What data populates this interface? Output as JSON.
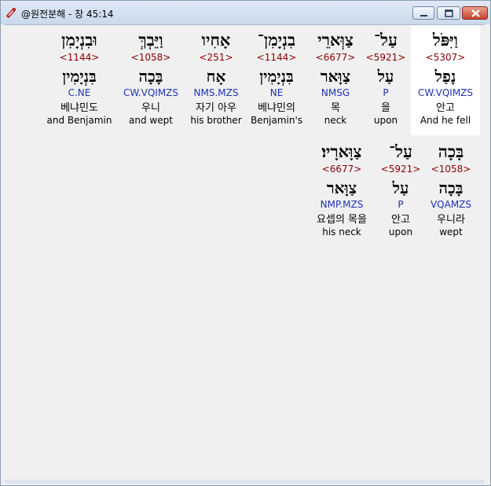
{
  "window": {
    "title": "@원전분해 - 창 45:14",
    "buttons": {
      "minimize": "minimize",
      "maximize": "maximize",
      "close": "close"
    }
  },
  "rows": [
    {
      "words": [
        {
          "hebrew": "וַיִּפֹּל",
          "strong": "<5307>",
          "lemma": "נָפַל",
          "morph": "CW.VQIMZS",
          "korean": "안고",
          "english": "And he fell",
          "highlighted": true
        },
        {
          "hebrew": "עַל־",
          "strong": "<5921>",
          "lemma": "עַל",
          "morph": "P",
          "korean": "을",
          "english": "upon",
          "highlighted": false
        },
        {
          "hebrew": "צַוְּארֵי",
          "strong": "<6677>",
          "lemma": "צַוָּאר",
          "morph": "NMSG",
          "korean": "목",
          "english": "neck",
          "highlighted": false
        },
        {
          "hebrew": "בִנְיָמִן־",
          "strong": "<1144>",
          "lemma": "בִּנְיָמִין",
          "morph": "NE",
          "korean": "베냐민의",
          "english": "Benjamin's",
          "highlighted": false
        },
        {
          "hebrew": "אָחִיו",
          "strong": "<251>",
          "lemma": "אָח",
          "morph": "NMS.MZS",
          "korean": "자기 아우",
          "english": "his brother",
          "highlighted": false
        },
        {
          "hebrew": "וַיֵּבְךְּ",
          "strong": "<1058>",
          "lemma": "בָּכָה",
          "morph": "CW.VQIMZS",
          "korean": "우니",
          "english": "and wept",
          "highlighted": false
        },
        {
          "hebrew": "וּבִנְיָמִן",
          "strong": "<1144>",
          "lemma": "בִּנְיָמִין",
          "morph": "C.NE",
          "korean": "베냐민도",
          "english": "and Benjamin",
          "highlighted": false
        }
      ]
    },
    {
      "words": [
        {
          "hebrew": "בָּכָה",
          "strong": "<1058>",
          "lemma": "בָּכָה",
          "morph": "VQAMZS",
          "korean": "우니라",
          "english": "wept",
          "highlighted": false
        },
        {
          "hebrew": "עַל־",
          "strong": "<5921>",
          "lemma": "עַל",
          "morph": "P",
          "korean": "안고",
          "english": "upon",
          "highlighted": false
        },
        {
          "hebrew": "צַוָּארָיו׃",
          "strong": "<6677>",
          "lemma": "צַוָּאר",
          "morph": "NMP.MZS",
          "korean": "요셉의 목을",
          "english": "his neck",
          "highlighted": false
        }
      ]
    }
  ],
  "colors": {
    "strong": "#8b0000",
    "morph": "#1e32b4",
    "highlight_bg": "#ffffff",
    "client_bg": "#f0f0f0"
  }
}
